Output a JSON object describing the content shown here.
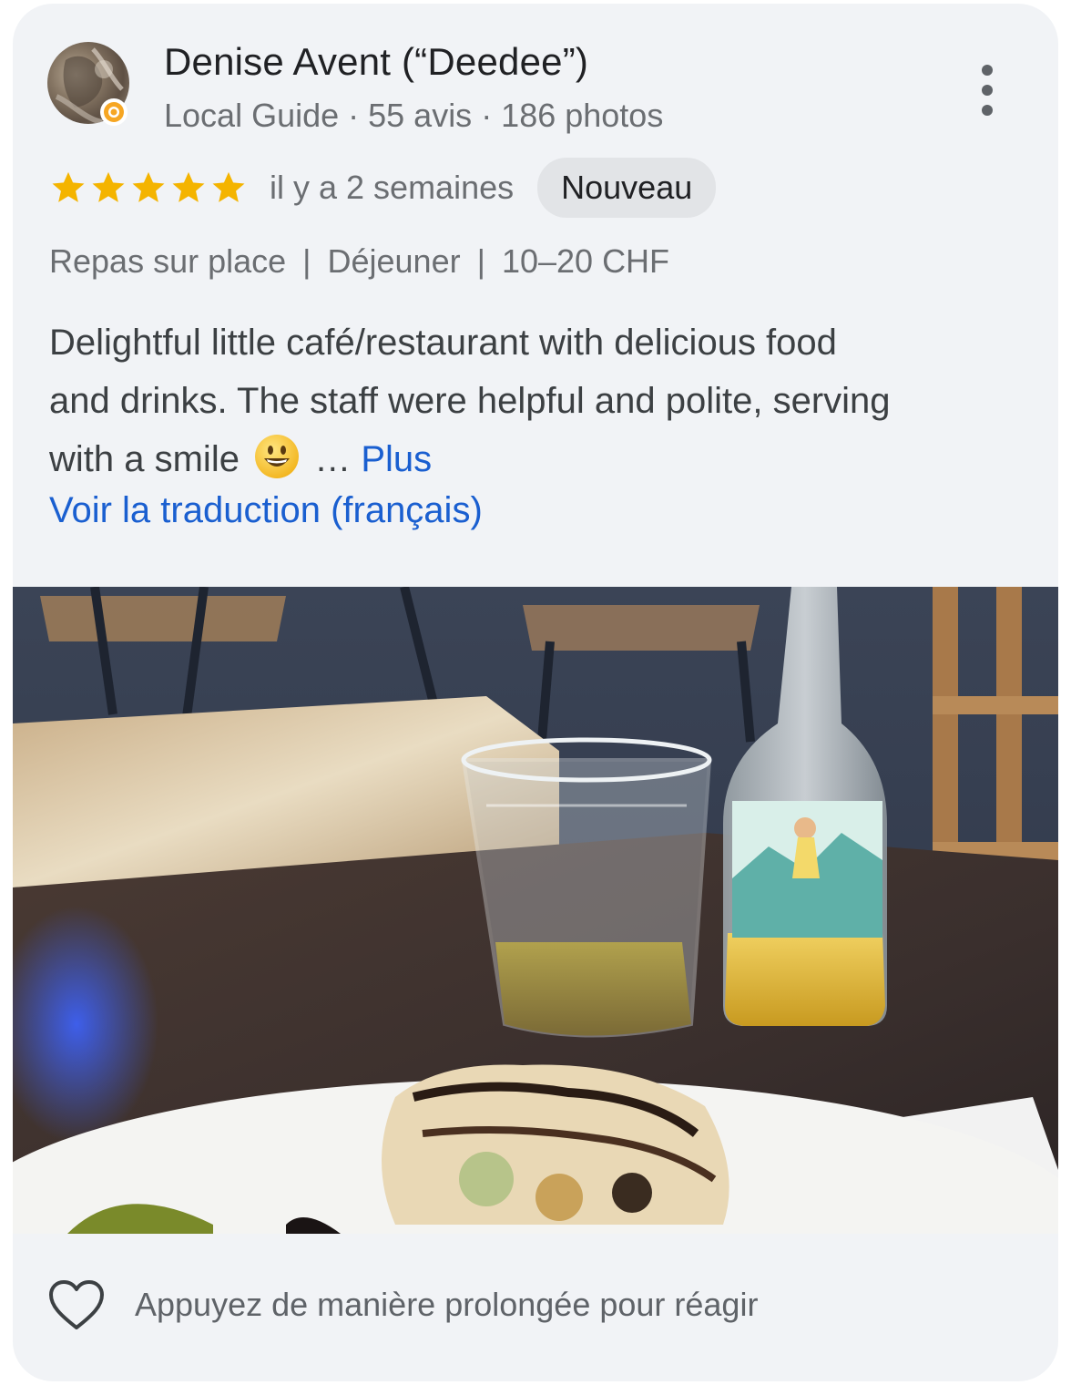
{
  "review": {
    "reviewer": {
      "name": "Denise Avent (“Deedee”)",
      "meta": "Local Guide · 55 avis · 186 photos",
      "badge_icon": "local-guide-badge-icon"
    },
    "rating": {
      "stars": 5,
      "max_stars": 5,
      "star_color": "#f4b400"
    },
    "time_ago": "il y a 2 semaines",
    "new_badge": "Nouveau",
    "attributes": [
      "Repas sur place",
      "Déjeuner",
      "10–20 CHF"
    ],
    "attribute_separator": "|",
    "text_lines": [
      "Delightful little café/restaurant with delicious food",
      "and drinks. The staff were helpful and polite, serving",
      "with a smile"
    ],
    "emoji_icon": "smiley-face-emoji-icon",
    "ellipsis": "…",
    "more_label": "Plus",
    "translate_label": "Voir la traduction (français)",
    "link_color": "#1a5fd0"
  },
  "photo": {
    "alt": "Photo of a glass, a bottle and a plate of food on a table"
  },
  "footer": {
    "react_hint": "Appuyez de manière prolongée pour réagir",
    "react_icon": "heart-outline-icon"
  },
  "more_options_icon": "more-vertical-icon"
}
